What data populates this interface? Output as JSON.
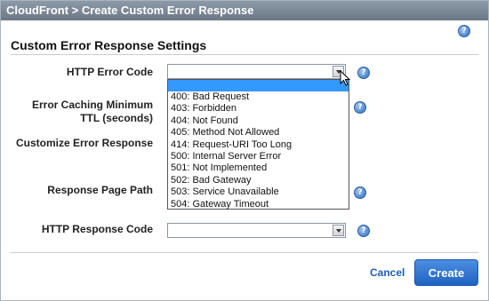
{
  "title": "CloudFront > Create Custom Error Response",
  "section_title": "Custom Error Response Settings",
  "help_glyph": "?",
  "fields": {
    "http_error_code": {
      "label": "HTTP Error Code",
      "value": ""
    },
    "error_caching_label_line1": "Error Caching Minimum",
    "error_caching_label_line2": "TTL (seconds)",
    "customize_error_response": "Customize Error Response",
    "response_page_path": "Response Page Path",
    "http_response_code": {
      "label": "HTTP Response Code",
      "value": ""
    }
  },
  "dropdown_options": [
    "400: Bad Request",
    "403: Forbidden",
    "404: Not Found",
    "405: Method Not Allowed",
    "414: Request-URI Too Long",
    "500: Internal Server Error",
    "501: Not Implemented",
    "502: Bad Gateway",
    "503: Service Unavailable",
    "504: Gateway Timeout"
  ],
  "buttons": {
    "cancel": "Cancel",
    "create": "Create"
  },
  "colors": {
    "title_bar": "#6b7886",
    "link": "#1a5fb4",
    "primary": "#1f63c2",
    "highlight": "#3399ff"
  }
}
